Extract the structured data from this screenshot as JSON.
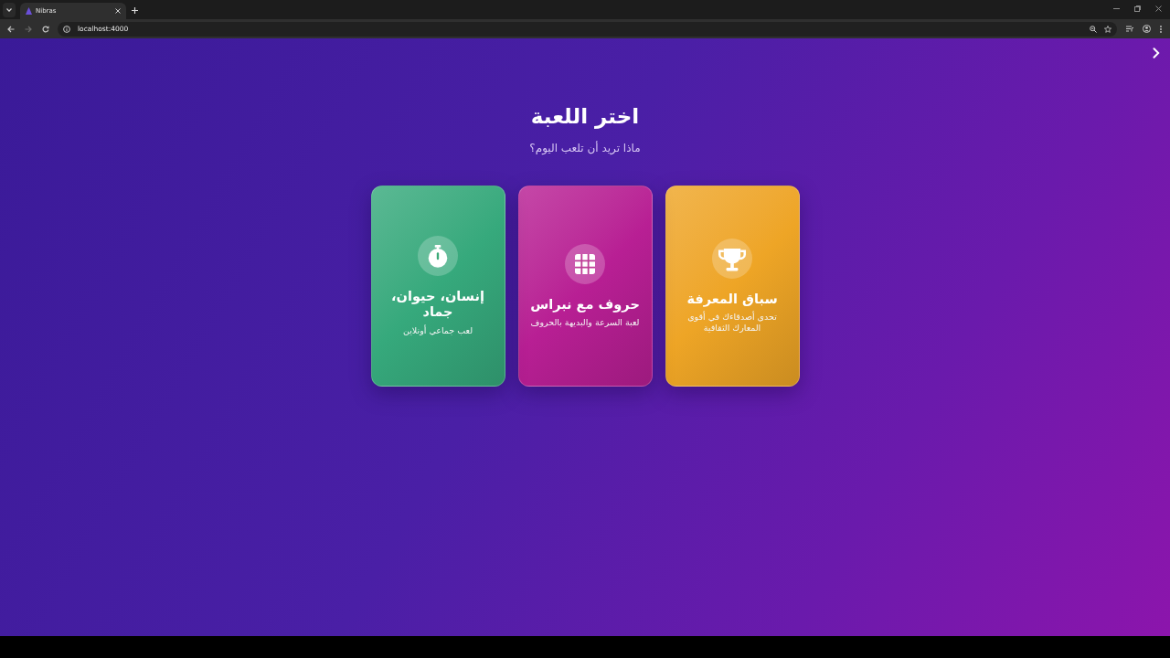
{
  "browser": {
    "tabs": [
      {
        "title": "Nibras",
        "selected": true
      }
    ],
    "url": "localhost:4000",
    "forward_disabled": true
  },
  "page": {
    "title": "اختر اللعبة",
    "subtitle": "ماذا تريد أن تلعب اليوم؟",
    "cards": [
      {
        "title": "سباق المعرفة",
        "description": "تحدى أصدقاءك في أقوى المعارك الثقافية",
        "color": "#eea526"
      },
      {
        "title": "حروف مع نبراس",
        "description": "لعبة السرعة والبديهة بالحروف",
        "color": "#b81f94"
      },
      {
        "title": "إنسان، حيوان، جماد",
        "description": "لعب جماعي أونلاين",
        "color": "#36a97c"
      }
    ]
  }
}
